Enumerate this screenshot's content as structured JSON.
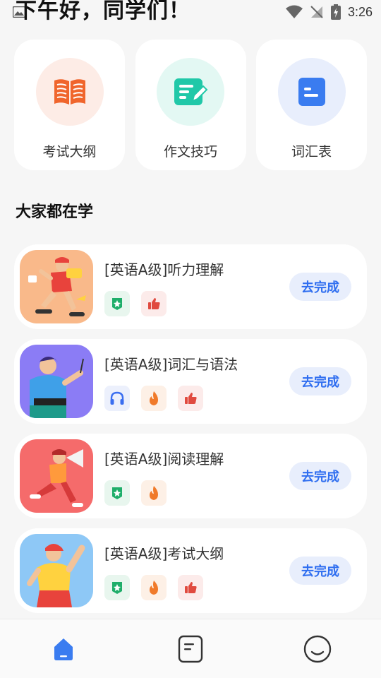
{
  "status_bar": {
    "time": "3:26"
  },
  "greeting": "下午好，同学们！",
  "shortcuts": [
    {
      "label": "考试大纲",
      "icon": "book-icon",
      "color": "#f0652c",
      "bg": "#fdece6"
    },
    {
      "label": "作文技巧",
      "icon": "edit-note-icon",
      "color": "#20c8a8",
      "bg": "#e3f8f3"
    },
    {
      "label": "词汇表",
      "icon": "list-doc-icon",
      "color": "#3a7cf0",
      "bg": "#e8eefc"
    }
  ],
  "section_title": "大家都在学",
  "courses": [
    {
      "title": "[英语A级]听力理解",
      "button": "去完成",
      "thumb_bg": "#f9b98a",
      "badges": [
        "green-star",
        "red-thumb"
      ]
    },
    {
      "title": "[英语A级]词汇与语法",
      "button": "去完成",
      "thumb_bg": "#8b7cf5",
      "badges": [
        "blue-headphone",
        "orange-fire",
        "red-thumb"
      ]
    },
    {
      "title": "[英语A级]阅读理解",
      "button": "去完成",
      "thumb_bg": "#f56b6b",
      "badges": [
        "green-star",
        "orange-fire"
      ]
    },
    {
      "title": "[英语A级]考试大纲",
      "button": "去完成",
      "thumb_bg": "#8ec8f6",
      "badges": [
        "green-star",
        "orange-fire",
        "red-thumb"
      ]
    }
  ],
  "nav": [
    {
      "name": "home",
      "icon": "home-icon",
      "active": true
    },
    {
      "name": "notes",
      "icon": "document-icon",
      "active": false
    },
    {
      "name": "profile",
      "icon": "smiley-icon",
      "active": false
    }
  ],
  "colors": {
    "accent": "#2f6ef0",
    "badge_green": "#1fae6a",
    "badge_orange": "#f07a2a",
    "badge_red": "#e04a3f"
  }
}
